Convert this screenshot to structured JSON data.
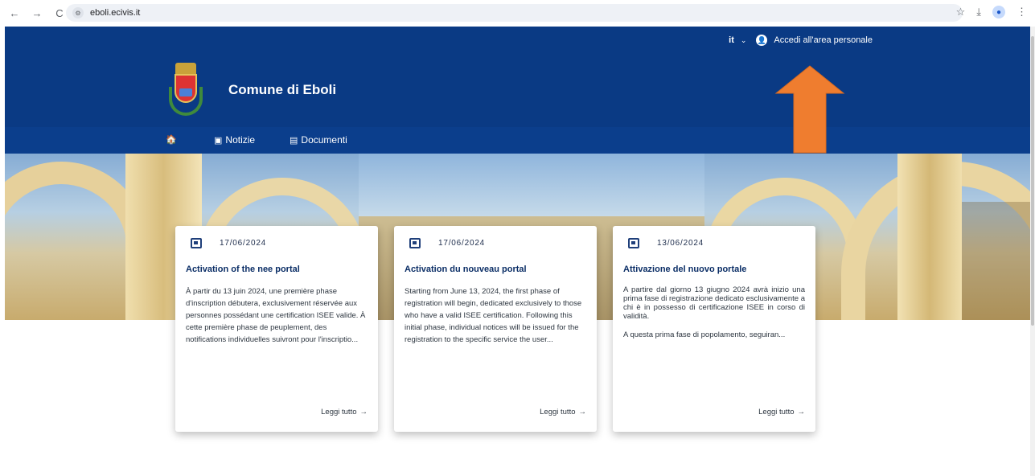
{
  "browser": {
    "url": "eboli.ecivis.it",
    "back_glyph": "←",
    "forward_glyph": "→",
    "reload_glyph": "C",
    "site_info_glyph": "⚙",
    "star_glyph": "☆",
    "download_glyph": "⤓",
    "profile_glyph": "●",
    "menu_glyph": "⋮"
  },
  "header": {
    "language": "it",
    "language_chevron": "⌄",
    "login_label": "Accedi all'area personale",
    "site_title": "Comune di Eboli",
    "background_color": "#0a3a84"
  },
  "nav": {
    "home_icon": "🏠",
    "notizie_label": "Notizie",
    "documenti_label": "Documenti"
  },
  "cards": [
    {
      "date": "17/06/2024",
      "title": "Activation of the nee portal",
      "paragraphs": [
        "À partir du 13 juin 2024, une première phase d'inscription débutera, exclusivement réservée aux personnes possédant une certification ISEE valide. À cette première phase de peuplement, des notifications individuelles suivront pour l'inscriptio..."
      ],
      "read_more": "Leggi tutto"
    },
    {
      "date": "17/06/2024",
      "title": "Activation du nouveau portal",
      "paragraphs": [
        "Starting from June 13, 2024, the first phase of registration will begin, dedicated exclusively to those who have a valid ISEE certification.  Following this initial phase, individual notices will be issued for the registration to the specific service the user..."
      ],
      "read_more": "Leggi tutto"
    },
    {
      "date": "13/06/2024",
      "title": "Attivazione del nuovo portale",
      "paragraphs": [
        "A partire dal giorno 13 giugno 2024 avrà inizio una prima fase di registrazione dedicato esclusivamente a chi è in possesso di certificazione ISEE in corso di validità.",
        "A questa prima fase di popolamento, seguiran..."
      ],
      "read_more": "Leggi tutto"
    }
  ],
  "annotation": {
    "arrow_color": "#ef7d2f"
  }
}
